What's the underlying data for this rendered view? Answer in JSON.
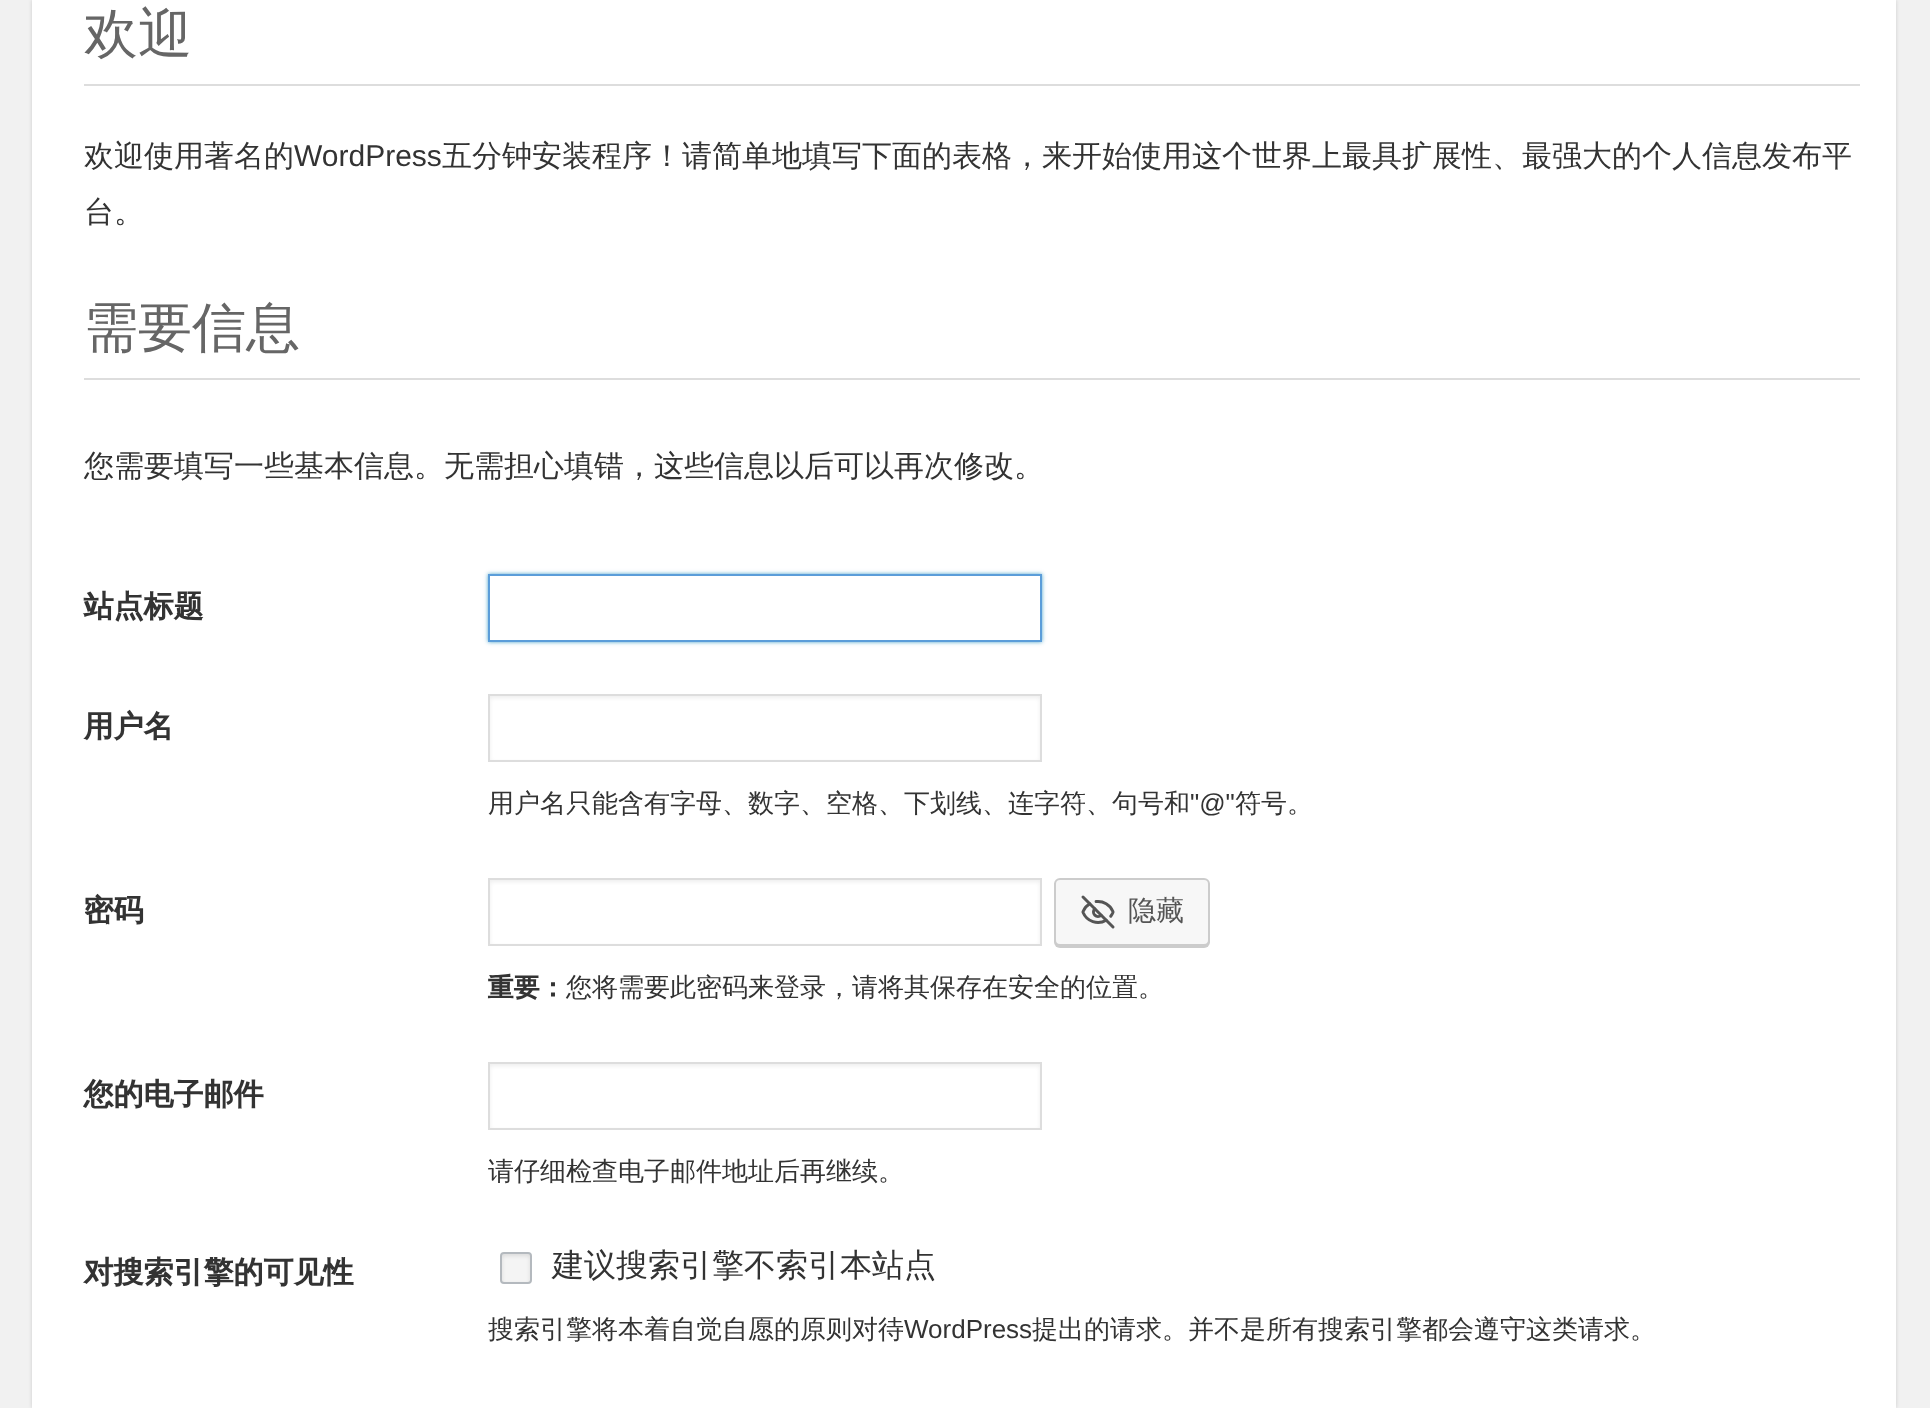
{
  "sections": [
    {
      "heading": "欢迎",
      "paragraph": "欢迎使用著名的WordPress五分钟安装程序！请简单地填写下面的表格，来开始使用这个世界上最具扩展性、最强大的个人信息发布平台。"
    },
    {
      "heading": "需要信息",
      "paragraph": "您需要填写一些基本信息。无需担心填错，这些信息以后可以再次修改。"
    }
  ],
  "form": [
    {
      "kind": "text",
      "label": "站点标题",
      "focused": true
    },
    {
      "kind": "text",
      "label": "用户名",
      "focused": false,
      "hint": "用户名只能含有字母、数字、空格、下划线、连字符、句号和\"@\"符号。"
    },
    {
      "kind": "password",
      "label": "密码",
      "focused": false,
      "button": "隐藏",
      "hint": "**重要：**您将需要此密码来登录，请将其保存在安全的位置。"
    },
    {
      "kind": "text",
      "label": "您的电子邮件",
      "focused": false,
      "hint": "请仔细检查电子邮件地址后再继续。"
    },
    {
      "kind": "checkbox",
      "label": "对搜索引擎的可见性",
      "checked": false,
      "option": "建议搜索引擎不索引本站点",
      "hint": "搜索引擎将本着自觉自愿的原则对待WordPress提出的请求。并不是所有搜索引擎都会遵守这类请求。"
    }
  ]
}
